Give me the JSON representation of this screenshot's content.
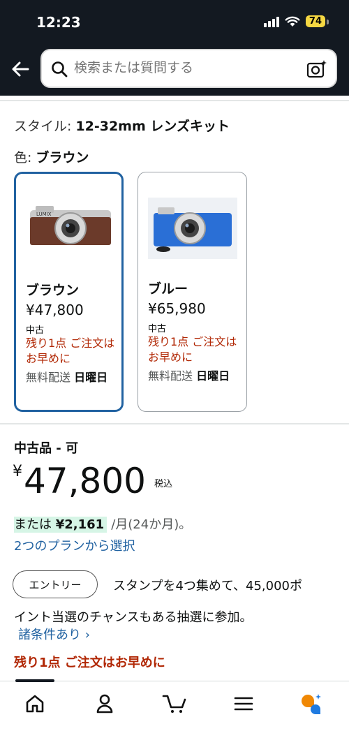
{
  "status": {
    "time": "12:23",
    "battery": "74"
  },
  "search": {
    "placeholder": "検索または質問する"
  },
  "style": {
    "label": "スタイル:",
    "value": "12-32mm レンズキット"
  },
  "color": {
    "label": "色:",
    "value": "ブラウン"
  },
  "variants": [
    {
      "name": "ブラウン",
      "price": "¥47,800",
      "condition": "中古",
      "stock": "残り1点 ご注文はお早めに",
      "ship_prefix": "無料配送",
      "ship_day": "日曜日",
      "selected": true,
      "body_color": "#6b3a2a"
    },
    {
      "name": "ブルー",
      "price": "¥65,980",
      "condition": "中古",
      "stock": "残り1点 ご注文はお早めに",
      "ship_prefix": "無料配送",
      "ship_day": "日曜日",
      "selected": false,
      "body_color": "#2a6fd6"
    }
  ],
  "offer": {
    "condition_title": "中古品 - 可",
    "price_symbol": "¥",
    "price": "47,800",
    "tax": "税込",
    "installment_prefix": "または",
    "installment_amount": "¥2,161",
    "installment_suffix": "/月(24か月)。",
    "plans_link": "2つのプランから選択",
    "entry_button": "エントリー",
    "promo_line1": "スタンプを4つ集めて、45,000ポ",
    "promo_line2": "イント当選のチャンスもある抽選に参加。",
    "terms_link": "諸条件あり ›",
    "stock_notice": "残り1点 ご注文はお早めに"
  },
  "colors": {
    "header_bg": "#131921",
    "link": "#2162a1",
    "alert": "#b12704",
    "selected_border": "#2162a1",
    "installment_highlight": "#d6f5e6"
  },
  "bottom_nav": [
    "home-icon",
    "account-icon",
    "cart-icon",
    "menu-icon",
    "rufus-icon"
  ]
}
